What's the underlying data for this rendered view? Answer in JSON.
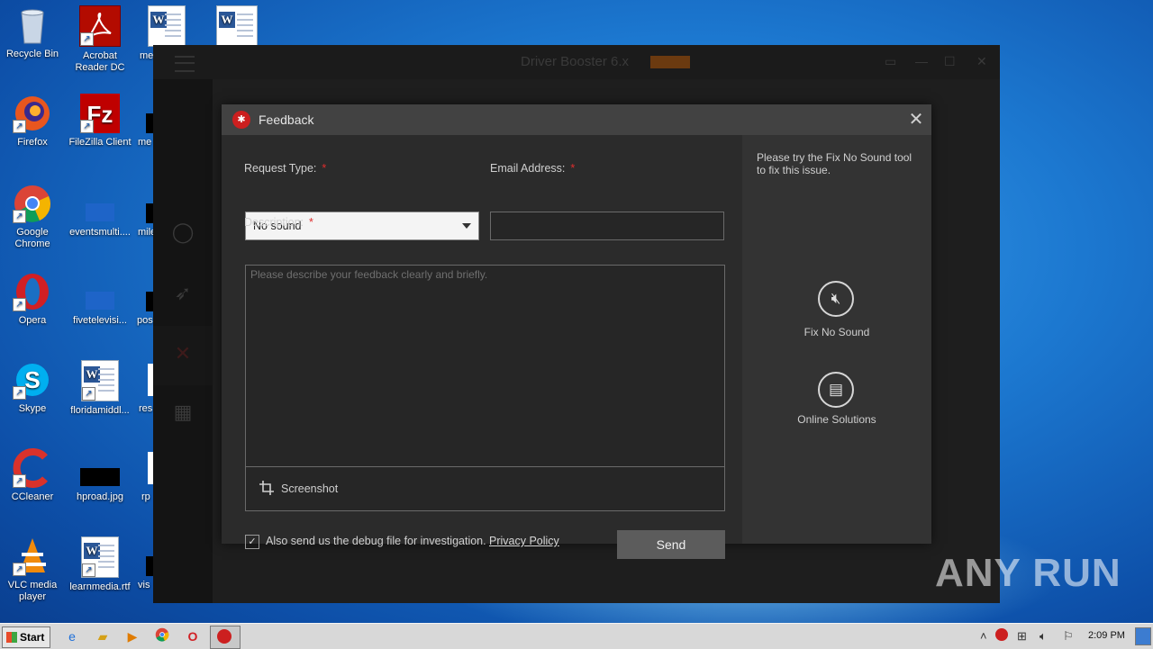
{
  "desktop": {
    "icons": [
      {
        "id": "recycle-bin",
        "label": "Recycle Bin"
      },
      {
        "id": "acrobat",
        "label": "Acrobat Reader DC"
      },
      {
        "id": "doc-me1",
        "label": "me"
      },
      {
        "id": "firefox",
        "label": "Firefox"
      },
      {
        "id": "filezilla",
        "label": "FileZilla Client"
      },
      {
        "id": "doc-me2",
        "label": "me"
      },
      {
        "id": "chrome",
        "label": "Google Chrome"
      },
      {
        "id": "eventsmulti",
        "label": "eventsmulti...."
      },
      {
        "id": "mile",
        "label": "mile"
      },
      {
        "id": "opera",
        "label": "Opera"
      },
      {
        "id": "fivetelevisi",
        "label": "fivetelevisi..."
      },
      {
        "id": "pos",
        "label": "pos"
      },
      {
        "id": "skype",
        "label": "Skype"
      },
      {
        "id": "floridamiddl",
        "label": "floridamiddl..."
      },
      {
        "id": "res",
        "label": "res"
      },
      {
        "id": "ccleaner",
        "label": "CCleaner"
      },
      {
        "id": "hproad",
        "label": "hproad.jpg"
      },
      {
        "id": "rp",
        "label": "rp"
      },
      {
        "id": "vlc",
        "label": "VLC media player"
      },
      {
        "id": "learnmedia",
        "label": "learnmedia.rtf"
      },
      {
        "id": "vis",
        "label": "vis"
      }
    ]
  },
  "background_app": {
    "title": "Driver Booster 6.x",
    "badge": "FREE"
  },
  "dialog": {
    "title": "Feedback",
    "request_type_label": "Request Type:",
    "request_type_value": "No sound",
    "email_label": "Email Address:",
    "email_value": "",
    "description_label": "Description:",
    "description_placeholder": "Please describe your feedback clearly and briefly.",
    "required_mark": "*",
    "screenshot_label": "Screenshot",
    "debug_checkbox_checked": true,
    "debug_checkbox_label": "Also send us the debug file for investigation.",
    "privacy_link": "Privacy Policy",
    "send_label": "Send",
    "side_tip": "Please try the Fix No Sound tool to fix this issue.",
    "fix_no_sound_label": "Fix No Sound",
    "online_solutions_label": "Online Solutions"
  },
  "watermark": "ANY RUN",
  "taskbar": {
    "start_label": "Start",
    "clock": "2:09 PM"
  }
}
